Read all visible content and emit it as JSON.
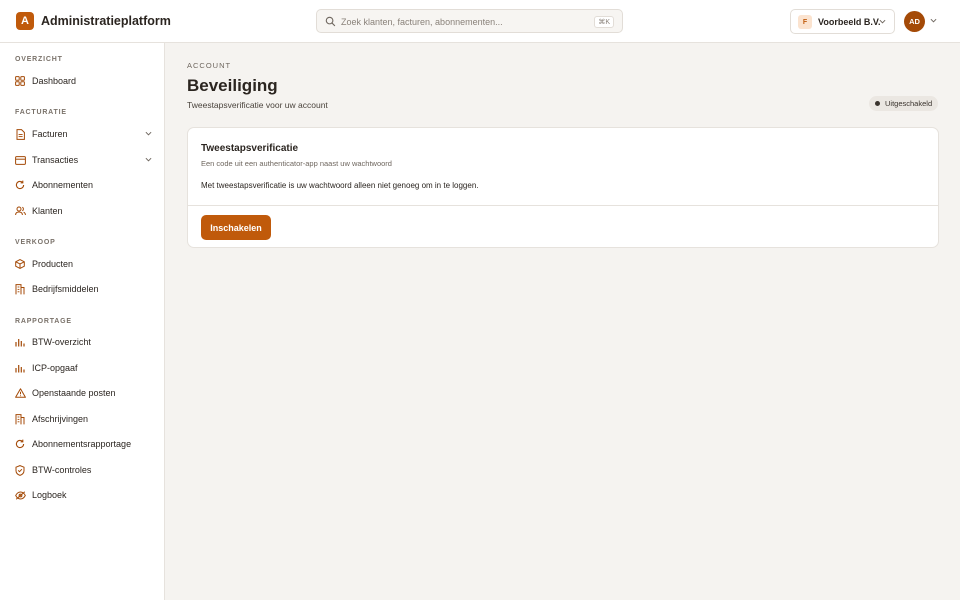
{
  "app": {
    "logo_letter": "A",
    "title": "Administratieplatform"
  },
  "search": {
    "placeholder": "Zoek klanten, facturen, abonnementen...",
    "shortcut": "⌘K"
  },
  "org": {
    "badge": "F",
    "name": "Voorbeeld B.V."
  },
  "user": {
    "initials": "AD"
  },
  "sidebar": {
    "sections": [
      {
        "label": "OVERZICHT",
        "items": [
          {
            "label": "Dashboard",
            "icon": "grid-icon"
          }
        ]
      },
      {
        "label": "FACTURATIE",
        "items": [
          {
            "label": "Facturen",
            "icon": "document-icon",
            "expandable": true
          },
          {
            "label": "Transacties",
            "icon": "card-icon",
            "expandable": true
          },
          {
            "label": "Abonnementen",
            "icon": "refresh-icon"
          },
          {
            "label": "Klanten",
            "icon": "users-icon"
          }
        ]
      },
      {
        "label": "VERKOOP",
        "items": [
          {
            "label": "Producten",
            "icon": "box-icon"
          },
          {
            "label": "Bedrijfsmiddelen",
            "icon": "building-icon"
          }
        ]
      },
      {
        "label": "RAPPORTAGE",
        "items": [
          {
            "label": "BTW-overzicht",
            "icon": "bar-chart-icon"
          },
          {
            "label": "ICP-opgaaf",
            "icon": "bar-chart-icon"
          },
          {
            "label": "Openstaande posten",
            "icon": "warning-icon"
          },
          {
            "label": "Afschrijvingen",
            "icon": "building-icon"
          },
          {
            "label": "Abonnementsrapportage",
            "icon": "refresh-icon"
          },
          {
            "label": "BTW-controles",
            "icon": "shield-check-icon"
          },
          {
            "label": "Logboek",
            "icon": "eye-off-icon"
          }
        ]
      }
    ]
  },
  "page": {
    "eyebrow": "ACCOUNT",
    "title": "Beveiliging",
    "subtitle": "Tweestapsverificatie voor uw account",
    "status": "Uitgeschakeld"
  },
  "card": {
    "title": "Tweestapsverificatie",
    "description": "Een code uit een authenticator-app naast uw wachtwoord",
    "body": "Met tweestapsverificatie is uw wachtwoord alleen niet genoeg om in te loggen.",
    "button": "Inschakelen"
  },
  "colors": {
    "accent": "#c05a0b",
    "background": "#f5f3f0"
  }
}
